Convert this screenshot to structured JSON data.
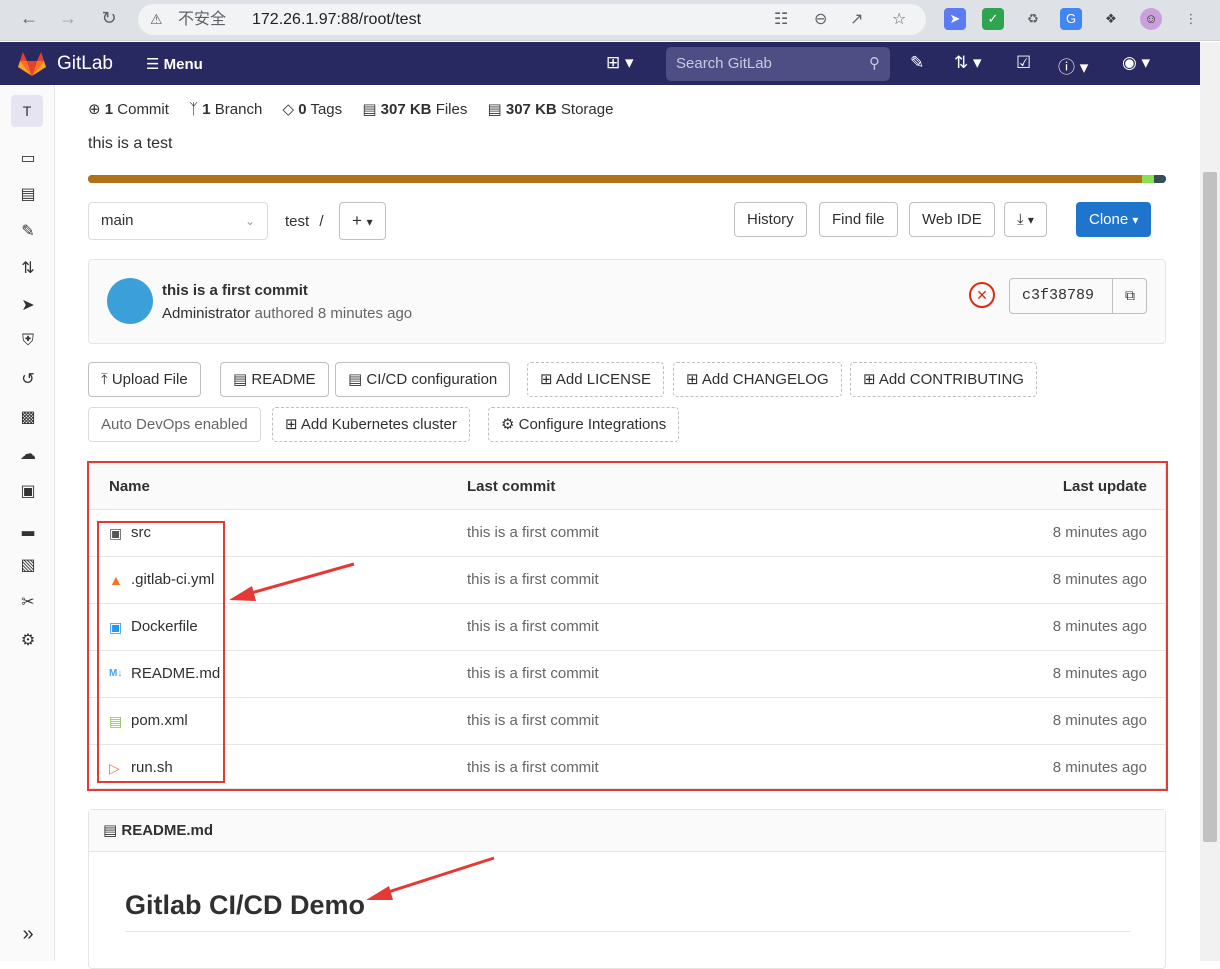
{
  "browser": {
    "insecure_label": "不安全",
    "url": "172.26.1.97:88/root/test"
  },
  "topbar": {
    "brand": "GitLab",
    "menu_label": "Menu",
    "search_placeholder": "Search GitLab"
  },
  "sidebar": {
    "project_initial": "T"
  },
  "project": {
    "stats": [
      {
        "num": "1",
        "label": "Commit"
      },
      {
        "num": "1",
        "label": "Branch"
      },
      {
        "num": "0",
        "label": "Tags"
      },
      {
        "num": "307 KB",
        "label": "Files"
      },
      {
        "num": "307 KB",
        "label": "Storage"
      }
    ],
    "description": "this is a test",
    "language_colors": [
      "#b07219",
      "#89e051",
      "#384d54"
    ]
  },
  "toolbar": {
    "branch": "main",
    "path": "test",
    "path_sep": "/",
    "history": "History",
    "find_file": "Find file",
    "web_ide": "Web IDE",
    "clone": "Clone"
  },
  "last_commit": {
    "title": "this is a first commit",
    "author": "Administrator",
    "meta": "authored 8 minutes ago",
    "sha": "c3f38789"
  },
  "actions": {
    "upload": "Upload File",
    "readme": "README",
    "cicd": "CI/CD configuration",
    "license": "Add LICENSE",
    "changelog": "Add CHANGELOG",
    "contributing": "Add CONTRIBUTING",
    "autodevops": "Auto DevOps enabled",
    "k8s": "Add Kubernetes cluster",
    "integrations": "Configure Integrations"
  },
  "table": {
    "headers": {
      "name": "Name",
      "last_commit": "Last commit",
      "last_update": "Last update"
    },
    "rows": [
      {
        "name": "src",
        "icon": "folder-icon",
        "commit": "this is a first commit",
        "updated": "8 minutes ago"
      },
      {
        "name": ".gitlab-ci.yml",
        "icon": "gitlab-icon",
        "commit": "this is a first commit",
        "updated": "8 minutes ago"
      },
      {
        "name": "Dockerfile",
        "icon": "docker-icon",
        "commit": "this is a first commit",
        "updated": "8 minutes ago"
      },
      {
        "name": "README.md",
        "icon": "markdown-icon",
        "commit": "this is a first commit",
        "updated": "8 minutes ago"
      },
      {
        "name": "pom.xml",
        "icon": "xml-icon",
        "commit": "this is a first commit",
        "updated": "8 minutes ago"
      },
      {
        "name": "run.sh",
        "icon": "shell-icon",
        "commit": "this is a first commit",
        "updated": "8 minutes ago"
      }
    ]
  },
  "readme": {
    "file": "README.md",
    "heading": "Gitlab CI/CD Demo"
  }
}
